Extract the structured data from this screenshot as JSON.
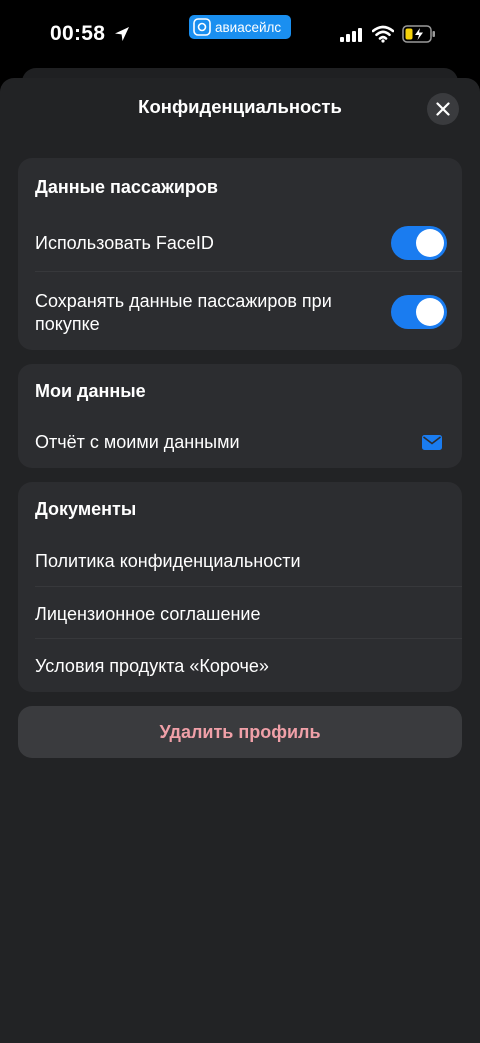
{
  "status_bar": {
    "time": "00:58",
    "app_label": "авиасейлс"
  },
  "sheet": {
    "title": "Конфиденциальность"
  },
  "passenger_section": {
    "title": "Данные пассажиров",
    "rows": [
      {
        "label": "Использовать FaceID",
        "toggle_on": true
      },
      {
        "label": "Сохранять данные пассажиров при покупке",
        "toggle_on": true
      }
    ]
  },
  "my_data_section": {
    "title": "Мои данные",
    "rows": [
      {
        "label": "Отчёт с моими данными",
        "icon": "mail-icon"
      }
    ]
  },
  "documents_section": {
    "title": "Документы",
    "rows": [
      {
        "label": "Политика конфиденциальности"
      },
      {
        "label": "Лицензионное соглашение"
      },
      {
        "label": "Условия продукта «Короче»"
      }
    ]
  },
  "delete_button": {
    "label": "Удалить профиль"
  },
  "colors": {
    "accent": "#1a7cf0",
    "danger_text": "#f0a0a8",
    "card_bg": "#2c2d30",
    "sheet_bg": "#222325"
  }
}
